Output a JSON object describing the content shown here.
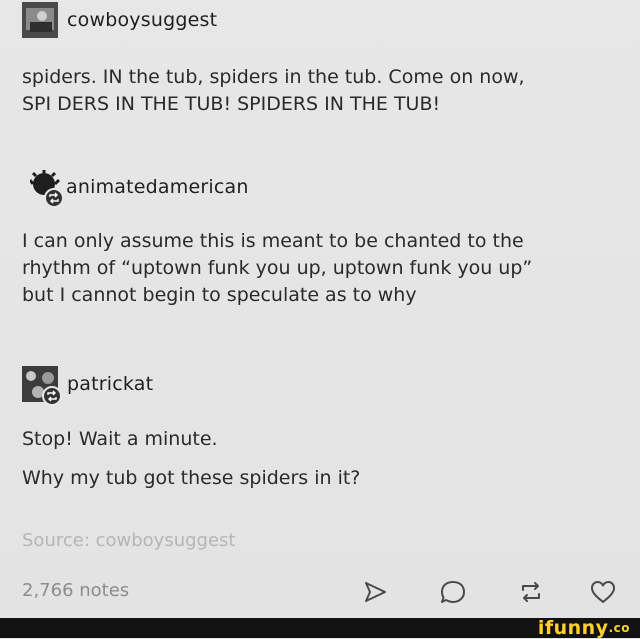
{
  "posts": [
    {
      "username": "cowboysuggest",
      "lines": [
        "spiders. IN the tub, spiders in the tub. Come on now,",
        "SPI DERS IN THE TUB! SPIDERS IN THE TUB!"
      ]
    },
    {
      "username": "animatedamerican",
      "lines": [
        "I can only assume this is meant to be chanted to the",
        "rhythm of “uptown funk you up, uptown funk you up”",
        "but I cannot begin to speculate as to why"
      ]
    },
    {
      "username": "patrickat",
      "lines": [
        "Stop!  Wait a minute.",
        "Why my tub got these spiders in it?"
      ]
    }
  ],
  "source": "Source: cowboysuggest",
  "notes": "2,766 notes",
  "actions": {
    "share_icon": "send-icon",
    "reply_icon": "reply-icon",
    "reblog_icon": "reblog-icon",
    "like_icon": "heart-icon"
  },
  "watermark": {
    "text": "ifunny",
    "suffix": ".co",
    "color": "#ffd12a"
  }
}
